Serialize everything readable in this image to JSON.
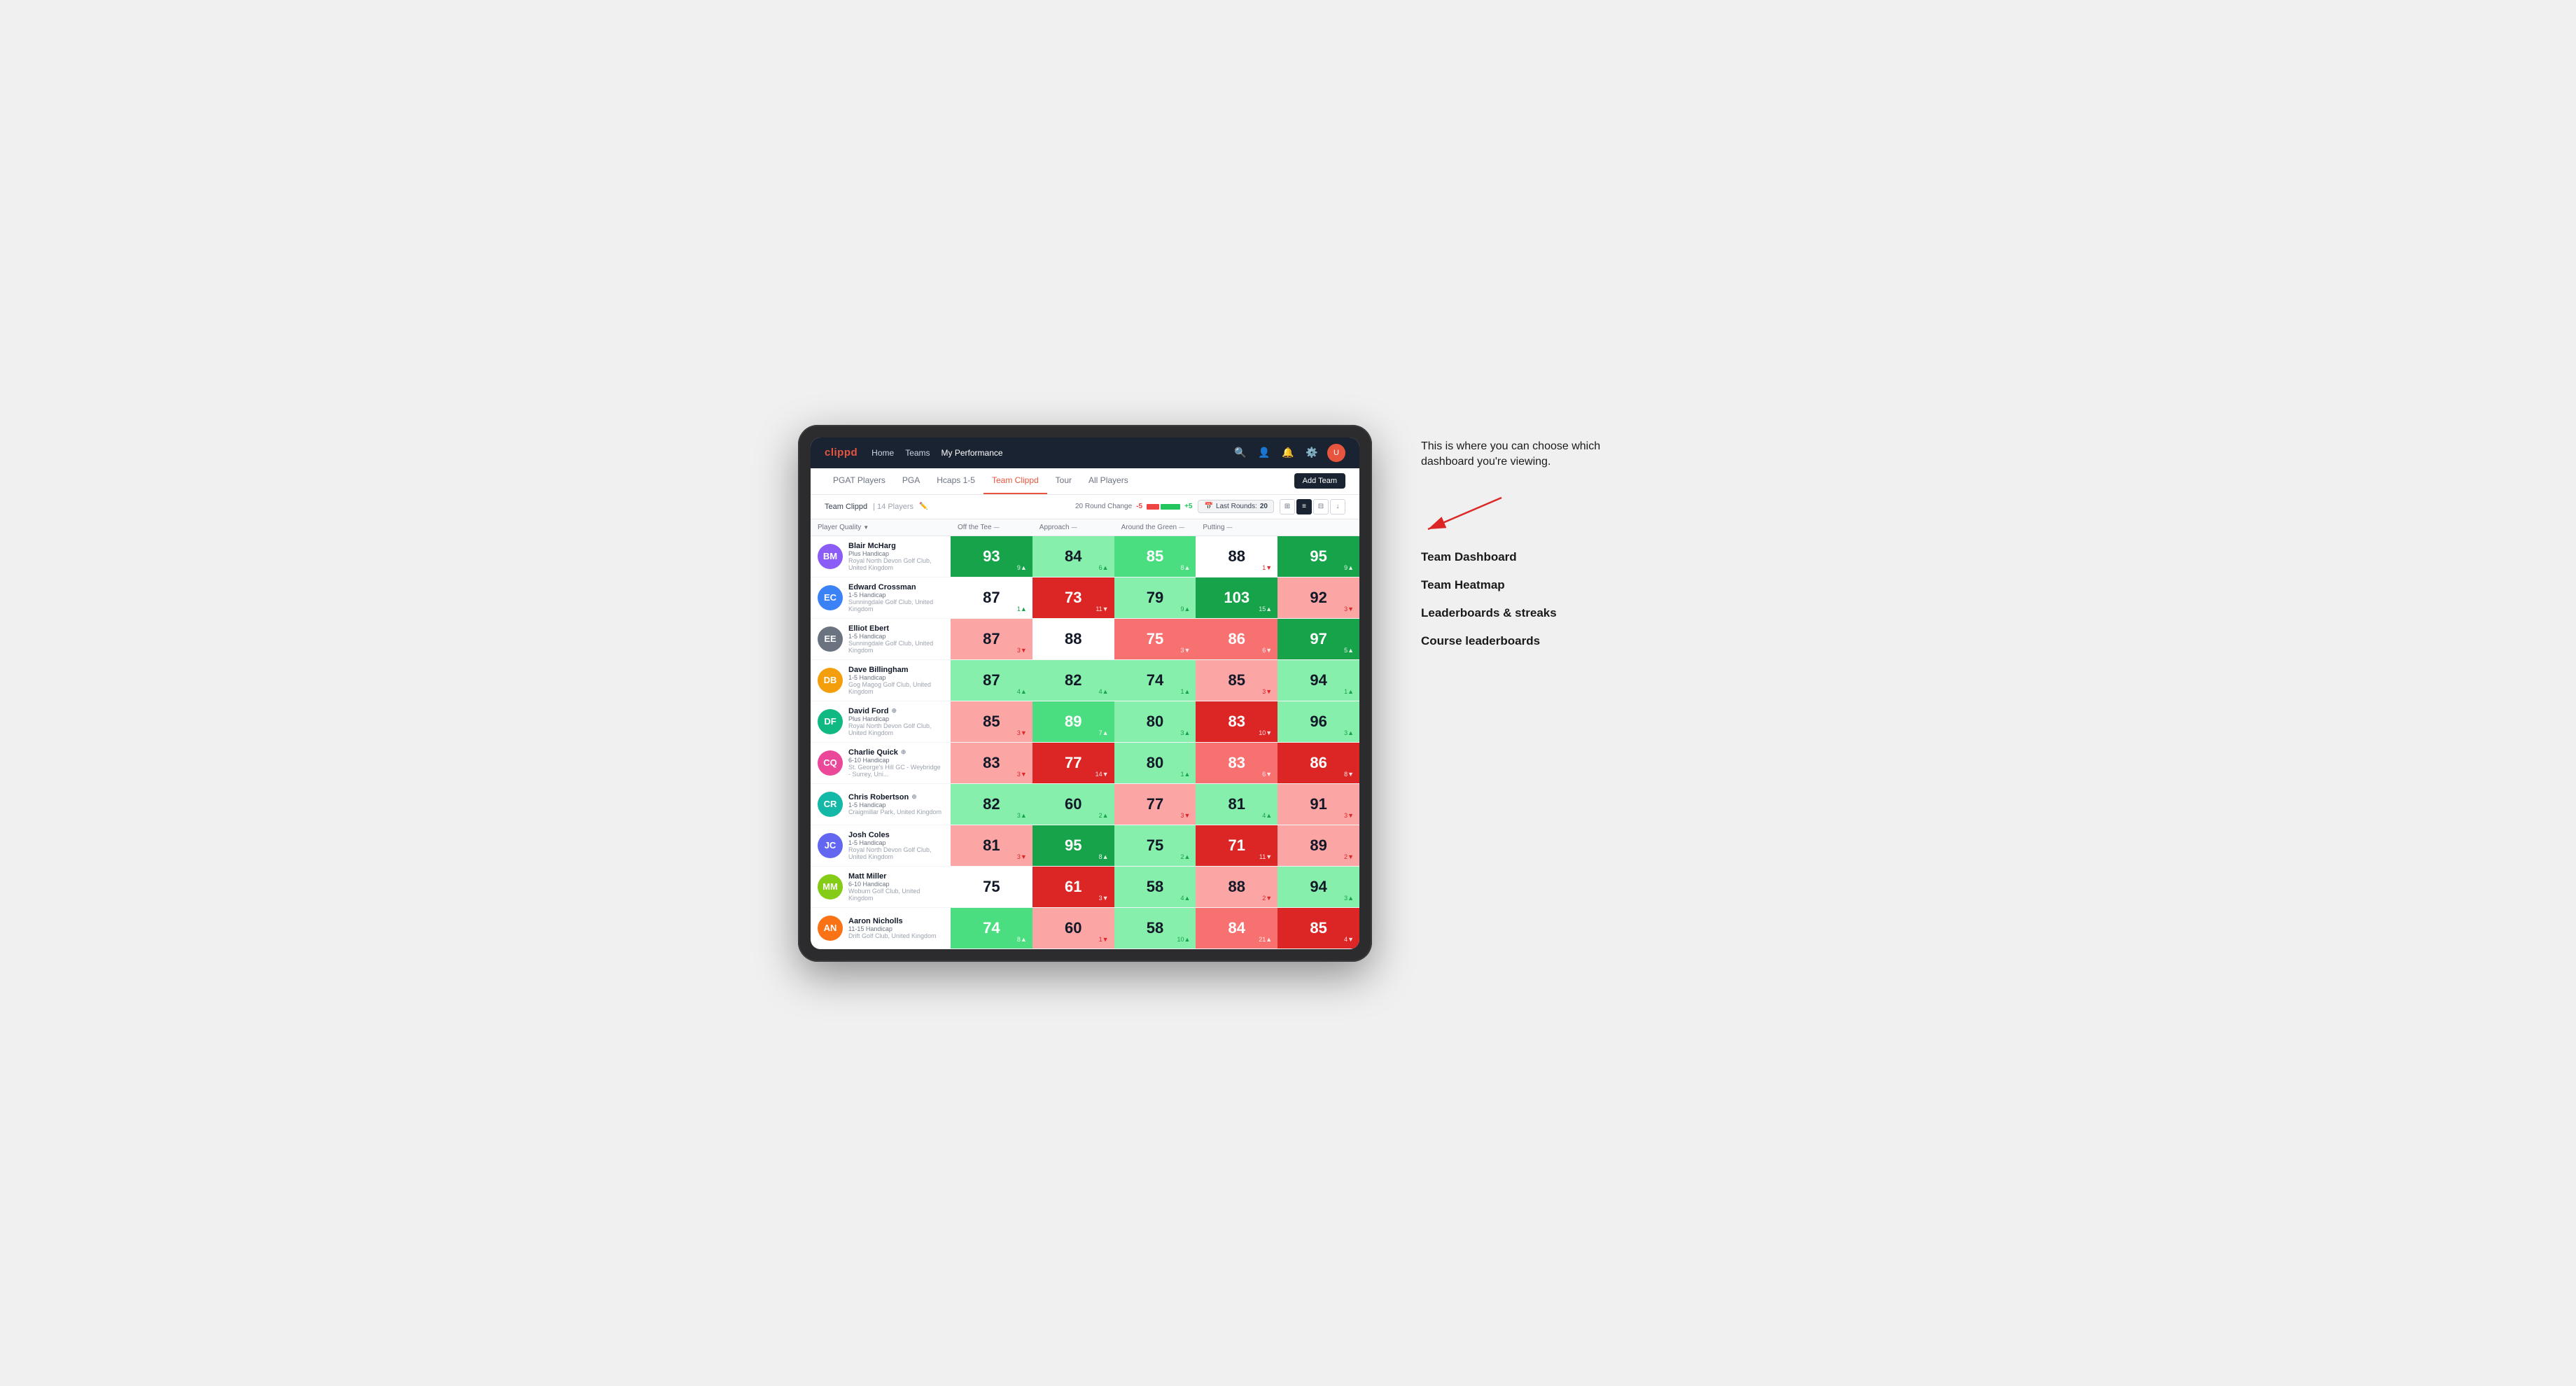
{
  "annotation": {
    "intro": "This is where you can choose which dashboard you're viewing.",
    "items": [
      "Team Dashboard",
      "Team Heatmap",
      "Leaderboards & streaks",
      "Course leaderboards"
    ]
  },
  "nav": {
    "logo": "clippd",
    "links": [
      {
        "label": "Home",
        "active": false
      },
      {
        "label": "Teams",
        "active": false
      },
      {
        "label": "My Performance",
        "active": true
      }
    ],
    "icons": [
      "search",
      "person",
      "bell",
      "settings",
      "avatar"
    ]
  },
  "sub_nav": {
    "links": [
      {
        "label": "PGAT Players",
        "active": false
      },
      {
        "label": "PGA",
        "active": false
      },
      {
        "label": "Hcaps 1-5",
        "active": false
      },
      {
        "label": "Team Clippd",
        "active": true
      },
      {
        "label": "Tour",
        "active": false
      },
      {
        "label": "All Players",
        "active": false
      }
    ],
    "add_team_label": "Add Team"
  },
  "team_header": {
    "name": "Team Clippd",
    "separator": "|",
    "count": "14 Players",
    "round_change_label": "20 Round Change",
    "change_minus": "-5",
    "change_plus": "+5",
    "last_rounds_label": "Last Rounds:",
    "last_rounds_value": "20"
  },
  "table": {
    "columns": [
      {
        "label": "Player Quality",
        "sortable": true
      },
      {
        "label": "Off the Tee",
        "sortable": true
      },
      {
        "label": "Approach",
        "sortable": true
      },
      {
        "label": "Around the Green",
        "sortable": true
      },
      {
        "label": "Putting",
        "sortable": true
      }
    ],
    "players": [
      {
        "name": "Blair McHarg",
        "badge": "",
        "handicap": "Plus Handicap",
        "club": "Royal North Devon Golf Club, United Kingdom",
        "initials": "BM",
        "scores": [
          {
            "value": "93",
            "change": "9▲",
            "dir": "up",
            "bg": "green-strong"
          },
          {
            "value": "84",
            "change": "6▲",
            "dir": "up",
            "bg": "green-light"
          },
          {
            "value": "85",
            "change": "8▲",
            "dir": "up",
            "bg": "green-medium"
          },
          {
            "value": "88",
            "change": "1▼",
            "dir": "down",
            "bg": "white"
          },
          {
            "value": "95",
            "change": "9▲",
            "dir": "up",
            "bg": "green-strong"
          }
        ]
      },
      {
        "name": "Edward Crossman",
        "badge": "",
        "handicap": "1-5 Handicap",
        "club": "Sunningdale Golf Club, United Kingdom",
        "initials": "EC",
        "scores": [
          {
            "value": "87",
            "change": "1▲",
            "dir": "up",
            "bg": "white"
          },
          {
            "value": "73",
            "change": "11▼",
            "dir": "down",
            "bg": "red-strong"
          },
          {
            "value": "79",
            "change": "9▲",
            "dir": "up",
            "bg": "green-light"
          },
          {
            "value": "103",
            "change": "15▲",
            "dir": "up",
            "bg": "green-strong"
          },
          {
            "value": "92",
            "change": "3▼",
            "dir": "down",
            "bg": "red-light"
          }
        ]
      },
      {
        "name": "Elliot Ebert",
        "badge": "",
        "handicap": "1-5 Handicap",
        "club": "Sunningdale Golf Club, United Kingdom",
        "initials": "EE",
        "scores": [
          {
            "value": "87",
            "change": "3▼",
            "dir": "down",
            "bg": "red-light"
          },
          {
            "value": "88",
            "change": "",
            "dir": "",
            "bg": "white"
          },
          {
            "value": "75",
            "change": "3▼",
            "dir": "down",
            "bg": "red-medium"
          },
          {
            "value": "86",
            "change": "6▼",
            "dir": "down",
            "bg": "red-medium"
          },
          {
            "value": "97",
            "change": "5▲",
            "dir": "up",
            "bg": "green-strong"
          }
        ]
      },
      {
        "name": "Dave Billingham",
        "badge": "",
        "handicap": "1-5 Handicap",
        "club": "Gog Magog Golf Club, United Kingdom",
        "initials": "DB",
        "scores": [
          {
            "value": "87",
            "change": "4▲",
            "dir": "up",
            "bg": "green-light"
          },
          {
            "value": "82",
            "change": "4▲",
            "dir": "up",
            "bg": "green-light"
          },
          {
            "value": "74",
            "change": "1▲",
            "dir": "up",
            "bg": "green-light"
          },
          {
            "value": "85",
            "change": "3▼",
            "dir": "down",
            "bg": "red-light"
          },
          {
            "value": "94",
            "change": "1▲",
            "dir": "up",
            "bg": "green-light"
          }
        ]
      },
      {
        "name": "David Ford",
        "badge": "⊕",
        "handicap": "Plus Handicap",
        "club": "Royal North Devon Golf Club, United Kingdom",
        "initials": "DF",
        "scores": [
          {
            "value": "85",
            "change": "3▼",
            "dir": "down",
            "bg": "red-light"
          },
          {
            "value": "89",
            "change": "7▲",
            "dir": "up",
            "bg": "green-medium"
          },
          {
            "value": "80",
            "change": "3▲",
            "dir": "up",
            "bg": "green-light"
          },
          {
            "value": "83",
            "change": "10▼",
            "dir": "down",
            "bg": "red-strong"
          },
          {
            "value": "96",
            "change": "3▲",
            "dir": "up",
            "bg": "green-light"
          }
        ]
      },
      {
        "name": "Charlie Quick",
        "badge": "⊕",
        "handicap": "6-10 Handicap",
        "club": "St. George's Hill GC - Weybridge - Surrey, Uni...",
        "initials": "CQ",
        "scores": [
          {
            "value": "83",
            "change": "3▼",
            "dir": "down",
            "bg": "red-light"
          },
          {
            "value": "77",
            "change": "14▼",
            "dir": "down",
            "bg": "red-strong"
          },
          {
            "value": "80",
            "change": "1▲",
            "dir": "up",
            "bg": "green-light"
          },
          {
            "value": "83",
            "change": "6▼",
            "dir": "down",
            "bg": "red-medium"
          },
          {
            "value": "86",
            "change": "8▼",
            "dir": "down",
            "bg": "red-strong"
          }
        ]
      },
      {
        "name": "Chris Robertson",
        "badge": "⊕",
        "handicap": "1-5 Handicap",
        "club": "Craigmillar Park, United Kingdom",
        "initials": "CR",
        "scores": [
          {
            "value": "82",
            "change": "3▲",
            "dir": "up",
            "bg": "green-light"
          },
          {
            "value": "60",
            "change": "2▲",
            "dir": "up",
            "bg": "green-light"
          },
          {
            "value": "77",
            "change": "3▼",
            "dir": "down",
            "bg": "red-light"
          },
          {
            "value": "81",
            "change": "4▲",
            "dir": "up",
            "bg": "green-light"
          },
          {
            "value": "91",
            "change": "3▼",
            "dir": "down",
            "bg": "red-light"
          }
        ]
      },
      {
        "name": "Josh Coles",
        "badge": "",
        "handicap": "1-5 Handicap",
        "club": "Royal North Devon Golf Club, United Kingdom",
        "initials": "JC",
        "scores": [
          {
            "value": "81",
            "change": "3▼",
            "dir": "down",
            "bg": "red-light"
          },
          {
            "value": "95",
            "change": "8▲",
            "dir": "up",
            "bg": "green-strong"
          },
          {
            "value": "75",
            "change": "2▲",
            "dir": "up",
            "bg": "green-light"
          },
          {
            "value": "71",
            "change": "11▼",
            "dir": "down",
            "bg": "red-strong"
          },
          {
            "value": "89",
            "change": "2▼",
            "dir": "down",
            "bg": "red-light"
          }
        ]
      },
      {
        "name": "Matt Miller",
        "badge": "",
        "handicap": "6-10 Handicap",
        "club": "Woburn Golf Club, United Kingdom",
        "initials": "MM",
        "scores": [
          {
            "value": "75",
            "change": "",
            "dir": "",
            "bg": "white"
          },
          {
            "value": "61",
            "change": "3▼",
            "dir": "down",
            "bg": "red-strong"
          },
          {
            "value": "58",
            "change": "4▲",
            "dir": "up",
            "bg": "green-light"
          },
          {
            "value": "88",
            "change": "2▼",
            "dir": "down",
            "bg": "red-light"
          },
          {
            "value": "94",
            "change": "3▲",
            "dir": "up",
            "bg": "green-light"
          }
        ]
      },
      {
        "name": "Aaron Nicholls",
        "badge": "",
        "handicap": "11-15 Handicap",
        "club": "Drift Golf Club, United Kingdom",
        "initials": "AN",
        "scores": [
          {
            "value": "74",
            "change": "8▲",
            "dir": "up",
            "bg": "green-medium"
          },
          {
            "value": "60",
            "change": "1▼",
            "dir": "down",
            "bg": "red-light"
          },
          {
            "value": "58",
            "change": "10▲",
            "dir": "up",
            "bg": "green-light"
          },
          {
            "value": "84",
            "change": "21▲",
            "dir": "up",
            "bg": "red-medium"
          },
          {
            "value": "85",
            "change": "4▼",
            "dir": "down",
            "bg": "red-strong"
          }
        ]
      }
    ]
  }
}
